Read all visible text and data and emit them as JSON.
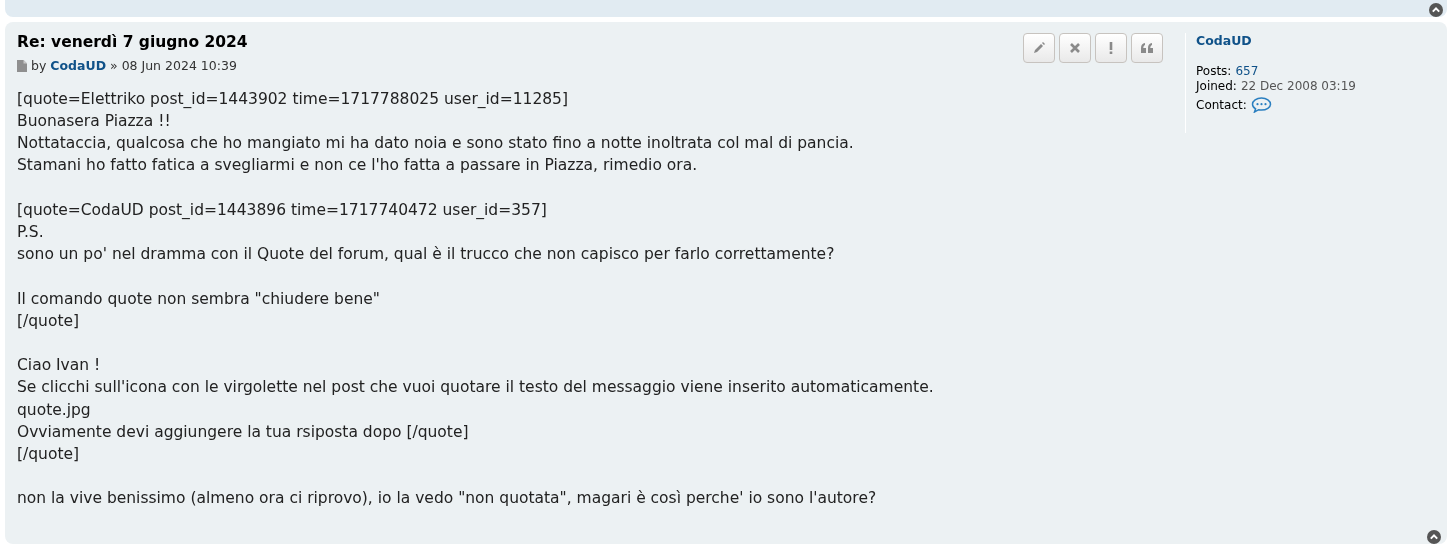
{
  "post": {
    "title": "Re: venerdì 7 giugno 2024",
    "meta": {
      "by": "by",
      "author": "CodaUD",
      "separator": "»",
      "date": "08 Jun 2024 10:39"
    },
    "body": [
      [
        "[quote=Elettriko post_id=1443902 time=1717788025 user_id=11285]",
        "Buonasera Piazza !!",
        "Nottataccia, qualcosa che ho mangiato mi ha dato noia e sono stato fino a notte inoltrata col mal di pancia.",
        "Stamani ho fatto fatica a svegliarmi e non ce l'ho fatta a passare in Piazza, rimedio ora."
      ],
      [
        "[quote=CodaUD post_id=1443896 time=1717740472 user_id=357]",
        "P.S.",
        "sono un po' nel dramma con il Quote del forum, qual è il trucco che non capisco per farlo correttamente?"
      ],
      [
        "Il comando quote non sembra \"chiudere bene\"",
        "[/quote]"
      ],
      [
        "Ciao Ivan !",
        "Se clicchi sull'icona con le virgolette nel post che vuoi quotare il testo del messaggio viene inserito automaticamente.",
        "quote.jpg",
        "Ovviamente devi aggiungere la tua rsiposta dopo [/quote]",
        "[/quote]"
      ],
      [
        "non la vive benissimo (almeno ora ci riprovo), io la vedo \"non quotata\", magari è così perche' io sono l'autore?"
      ]
    ],
    "buttons": [
      {
        "kind": "edit"
      },
      {
        "kind": "delete"
      },
      {
        "kind": "report"
      },
      {
        "kind": "quote"
      }
    ]
  },
  "profile": {
    "username": "CodaUD",
    "fields": [
      {
        "label": "Posts:",
        "value": "657",
        "kind": "link"
      },
      {
        "label": "Joined:",
        "value": "22 Dec 2008 03:19",
        "kind": "text"
      },
      {
        "label": "Contact:",
        "kind": "contact"
      }
    ]
  }
}
